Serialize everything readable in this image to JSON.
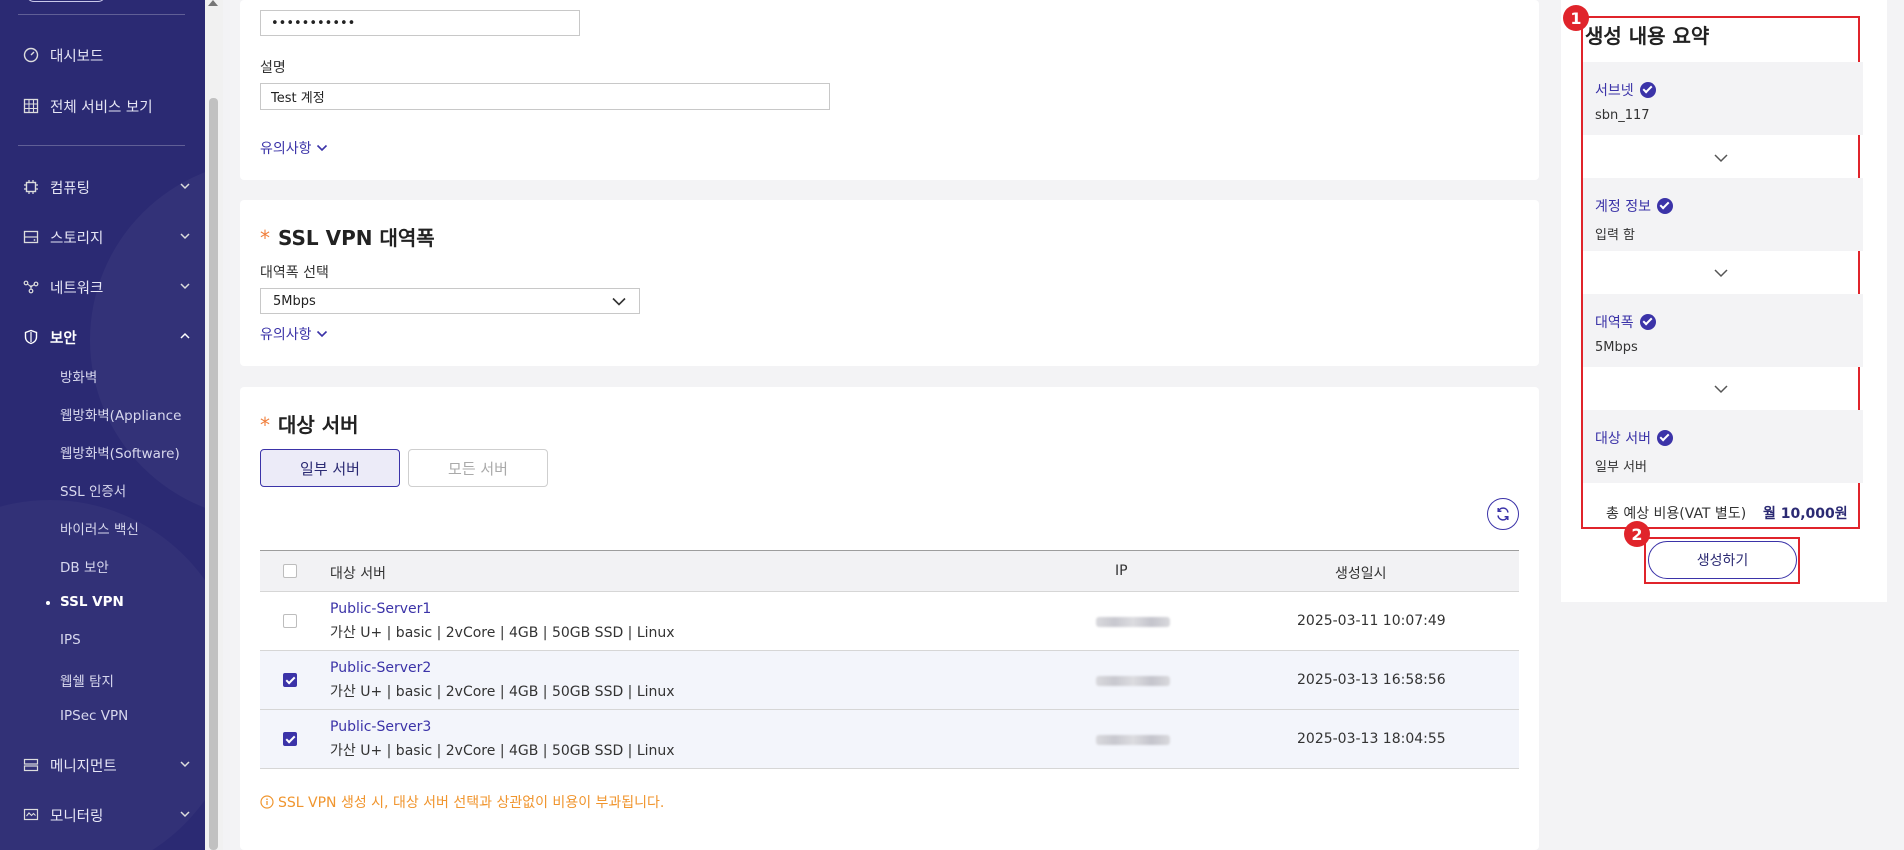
{
  "sidebar": {
    "items": {
      "dashboard": "대시보드",
      "all_services": "전체 서비스 보기",
      "computing": "컴퓨팅",
      "storage": "스토리지",
      "network": "네트워크",
      "security": "보안",
      "management": "메니지먼트",
      "monitoring": "모니터링"
    },
    "security_sub": [
      "방화벽",
      "웹방화벽(Appliance",
      "웹방화벽(Software)",
      "SSL 인증서",
      "바이러스 백신",
      "DB 보안",
      "SSL VPN",
      "IPS",
      "웹쉘 탐지",
      "IPSec VPN"
    ]
  },
  "account": {
    "password_value": "•••••••••••",
    "desc_label": "설명",
    "desc_value": "Test 계정",
    "notice": "유의사항"
  },
  "bandwidth": {
    "title": "SSL VPN 대역폭",
    "required_mark": "*",
    "select_label": "대역폭 선택",
    "selected": "5Mbps",
    "notice": "유의사항"
  },
  "target": {
    "title": "대상 서버",
    "required_mark": "*",
    "toggle_some": "일부 서버",
    "toggle_all": "모든 서버",
    "columns": {
      "server": "대상 서버",
      "ip": "IP",
      "created": "생성일시"
    },
    "rows": [
      {
        "name": "Public-Server1",
        "spec": "가산 U+ | basic | 2vCore | 4GB | 50GB SSD | Linux",
        "date": "2025-03-11 10:07:49"
      },
      {
        "name": "Public-Server2",
        "spec": "가산 U+ | basic | 2vCore | 4GB | 50GB SSD | Linux",
        "date": "2025-03-13 16:58:56"
      },
      {
        "name": "Public-Server3",
        "spec": "가산 U+ | basic | 2vCore | 4GB | 50GB SSD | Linux",
        "date": "2025-03-13 18:04:55"
      }
    ],
    "warning": "SSL VPN 생성 시, 대상 서버 선택과 상관없이 비용이 부과됩니다."
  },
  "summary": {
    "title": "생성 내용 요약",
    "badge1": "1",
    "badge2": "2",
    "steps": [
      {
        "label": "서브넷",
        "value": "sbn_117"
      },
      {
        "label": "계정 정보",
        "value": "입력 함"
      },
      {
        "label": "대역폭",
        "value": "5Mbps"
      },
      {
        "label": "대상 서버",
        "value": "일부 서버"
      }
    ],
    "cost_label": "총 예상 비용(VAT 별도)",
    "cost_value": "월 10,000원",
    "create_button": "생성하기"
  },
  "colors": {
    "sidebar": "#2b2a73",
    "accent": "#3b33a8",
    "highlight": "#e0242b",
    "warning": "#f0952e"
  }
}
